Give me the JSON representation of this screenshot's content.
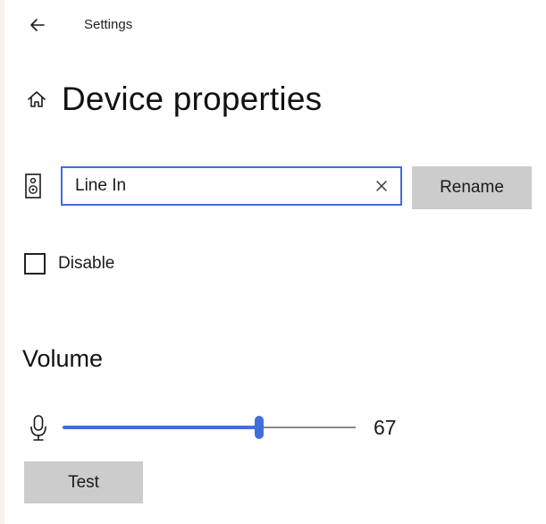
{
  "titlebar": {
    "back_icon": "arrow-left-icon",
    "app_title": "Settings"
  },
  "header": {
    "home_icon": "home-icon",
    "title": "Device properties"
  },
  "device": {
    "icon": "speaker-icon",
    "name_value": "Line In",
    "clear_icon": "close-icon",
    "rename_label": "Rename"
  },
  "disable": {
    "label": "Disable",
    "checked": false
  },
  "volume": {
    "heading": "Volume",
    "icon": "microphone-icon",
    "value": "67",
    "fraction": 0.67,
    "test_label": "Test"
  },
  "colors": {
    "accent": "#3f6fd8",
    "button_bg": "#cccccc",
    "track": "#8a8a8a"
  }
}
